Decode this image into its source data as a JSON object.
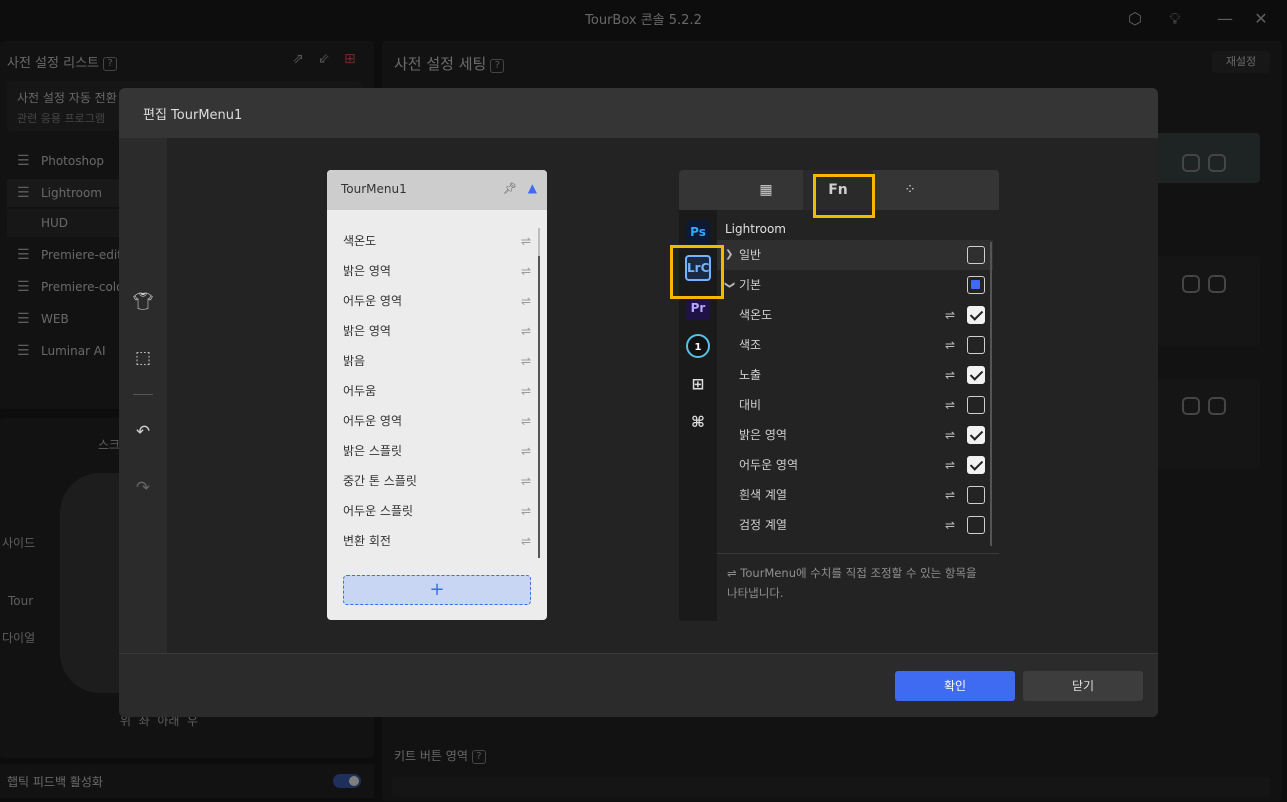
{
  "app": {
    "title": "TourBox 콘솔 5.2.2"
  },
  "left": {
    "header": "사전 설정 리스트",
    "auto_switch": {
      "title": "사전 설정 자동 전환",
      "sub": "관련 응용 프로그램"
    },
    "presets": [
      "Photoshop",
      "Lightroom",
      "HUD",
      "Premiere-edit",
      "Premiere-color",
      "WEB",
      "Luminar AI"
    ],
    "device_labels": {
      "side": "사이드",
      "tour": "Tour",
      "dial": "다이얼",
      "scroll": "스크",
      "nav": "위  좌  아래  우"
    },
    "haptic_label": "햅틱 피드백 활성화"
  },
  "right": {
    "header": "사전 설정 세팅",
    "reset": "재설정",
    "kit_label": "키트 버튼 영역"
  },
  "modal": {
    "title": "편집 TourMenu1",
    "confirm": "확인",
    "close": "닫기",
    "tourmenu": {
      "name": "TourMenu1",
      "items": [
        "색온도",
        "밝은 영역",
        "어두운 영역",
        "밝은 영역",
        "밝음",
        "어두움",
        "어두운 영역",
        "밝은 스플릿",
        "중간 톤 스플릿",
        "어두운 스플릿",
        "변환 회전"
      ],
      "add": "+"
    },
    "functions": {
      "tabs": [
        "grid-icon",
        "Fn",
        "dots-icon"
      ],
      "active_tab": "Fn",
      "apps": [
        "Ps",
        "LrC",
        "Pr",
        "C1",
        "Windows",
        "Mac"
      ],
      "app_title": "Lightroom",
      "groups": [
        {
          "name": "일반",
          "expanded": false,
          "state": "unchecked"
        },
        {
          "name": "기본",
          "expanded": true,
          "state": "partial"
        }
      ],
      "items": [
        {
          "name": "색온도",
          "checked": true
        },
        {
          "name": "색조",
          "checked": false
        },
        {
          "name": "노출",
          "checked": true
        },
        {
          "name": "대비",
          "checked": false
        },
        {
          "name": "밝은 영역",
          "checked": true
        },
        {
          "name": "어두운 영역",
          "checked": true
        },
        {
          "name": "흰색 계열",
          "checked": false
        },
        {
          "name": "검정 계열",
          "checked": false
        }
      ],
      "note": "TourMenu에 수치를 직접 조정할 수 있는 항목을 나타냅니다."
    }
  },
  "colors": {
    "accent": "#3e6bf2",
    "highlight": "#f5b800"
  }
}
